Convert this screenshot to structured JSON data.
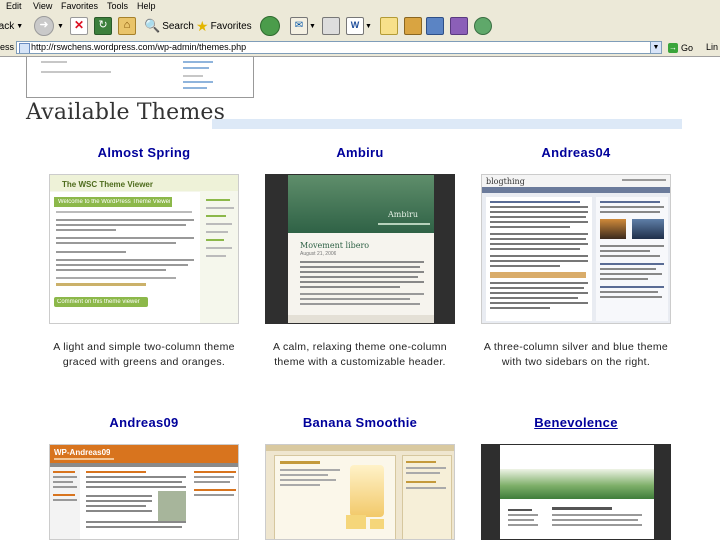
{
  "browser": {
    "menu": [
      "Edit",
      "View",
      "Favorites",
      "Tools",
      "Help"
    ],
    "toolbar": {
      "back_label": "Back",
      "search_label": "Search",
      "favorites_label": "Favorites"
    },
    "address": {
      "label": "ess",
      "url": "http://rswchens.wordpress.com/wp-admin/themes.php",
      "go_label": "Go",
      "links_label": "Lin"
    }
  },
  "page": {
    "title": "Available Themes",
    "themes": [
      {
        "name": "Almost Spring",
        "description": "A light and simple two-column theme graced with greens and oranges.",
        "preview": {
          "blog_title": "The WSC Theme Viewer",
          "post_title": "Welcome to the WordPress Theme Viewer!",
          "comment_label": "Comment on this theme viewer"
        }
      },
      {
        "name": "Ambiru",
        "description": "A calm, relaxing theme one-column theme with a customizable header.",
        "preview": {
          "blog_title": "Ambiru",
          "post_title": "Movement libero",
          "post_date": "August 21, 2006"
        }
      },
      {
        "name": "Andreas04",
        "description": "A three-column silver and blue theme with two sidebars on the right.",
        "preview": {
          "blog_title": "blogthing"
        }
      },
      {
        "name": "Andreas09",
        "description": "",
        "preview": {
          "blog_title": "WP-Andreas09"
        }
      },
      {
        "name": "Banana Smoothie",
        "description": "",
        "preview": {}
      },
      {
        "name": "Benevolence",
        "description": "",
        "preview": {}
      }
    ]
  },
  "colors": {
    "link": "#00019b",
    "title_rule": "#dde9f7",
    "chrome": "#ece9d8"
  }
}
